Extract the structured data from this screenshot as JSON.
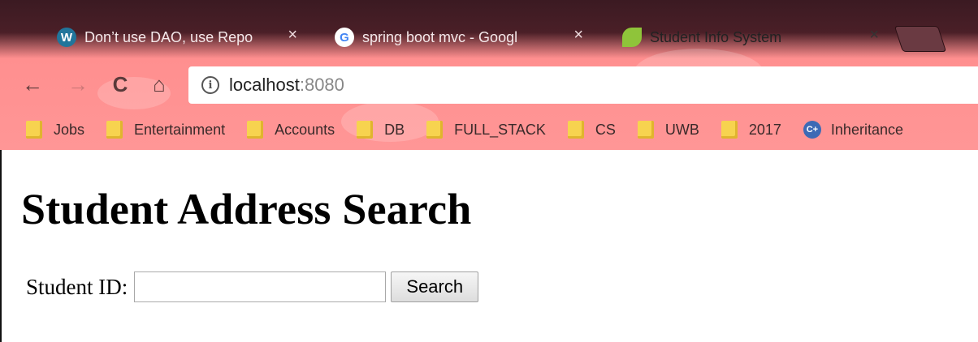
{
  "browser": {
    "tabs": [
      {
        "title": "Don’t use DAO, use Repo",
        "favicon": "wordpress-icon",
        "close": "×",
        "active": false
      },
      {
        "title": "spring boot mvc - Googl",
        "favicon": "google-icon",
        "close": "×",
        "active": false
      },
      {
        "title": "Student Info System",
        "favicon": "spring-leaf-icon",
        "close": "×",
        "active": true
      }
    ],
    "nav": {
      "back": "←",
      "forward": "→",
      "reload": "C",
      "home": "⌂"
    },
    "address": {
      "host": "localhost",
      "port": ":8080",
      "info_glyph": "i"
    },
    "bookmarks": [
      {
        "label": "Jobs",
        "icon": "folder-icon"
      },
      {
        "label": "Entertainment",
        "icon": "folder-icon"
      },
      {
        "label": "Accounts",
        "icon": "folder-icon"
      },
      {
        "label": "DB",
        "icon": "folder-icon"
      },
      {
        "label": "FULL_STACK",
        "icon": "folder-icon"
      },
      {
        "label": "CS",
        "icon": "folder-icon"
      },
      {
        "label": "UWB",
        "icon": "folder-icon"
      },
      {
        "label": "2017",
        "icon": "folder-icon"
      },
      {
        "label": "Inheritance",
        "icon": "cpp-icon"
      }
    ],
    "colors": {
      "theme_pink": "#ff9696",
      "tab_dark": "#5a2630"
    }
  },
  "page": {
    "heading": "Student Address Search",
    "form": {
      "label": "Student ID:",
      "input_value": "",
      "button": "Search"
    }
  }
}
